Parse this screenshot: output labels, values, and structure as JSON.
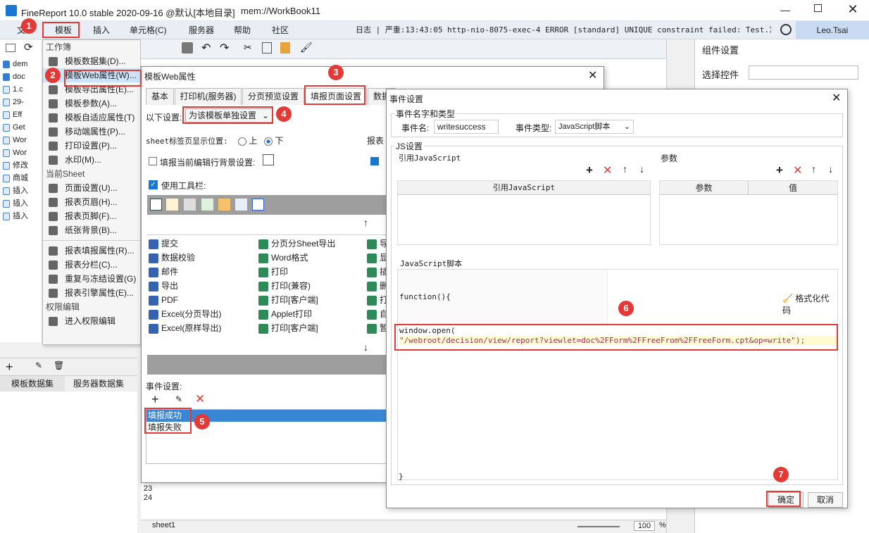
{
  "app": {
    "title": "FineReport 10.0 stable 2020-09-16 @默认[本地目录]",
    "workbook": "mem://WorkBook11"
  },
  "menu": {
    "items": [
      "文",
      "模板",
      "插入",
      "单元格(C)",
      "服务器",
      "帮助",
      "社区"
    ],
    "log": "日志 | 严重:13:43:05 http-nio-8075-exec-4 ERROR [standard] UNIQUE constraint failed: Test.ID",
    "user": "Leo.Tsai"
  },
  "dropdown": {
    "sec1": "工作簿",
    "items1": [
      "模板数据集(D)...",
      "模板Web属性(W)...",
      "模板导出属性(E)...",
      "模板参数(A)...",
      "模板自适应属性(T)",
      "移动端属性(P)...",
      "打印设置(P)...",
      "水印(M)..."
    ],
    "sec2": "当前Sheet",
    "items2": [
      "页面设置(U)...",
      "报表页眉(H)...",
      "报表页脚(F)...",
      "纸张背景(B)..."
    ],
    "items3": [
      "报表填报属性(R)...",
      "报表分栏(C)...",
      "重复与冻结设置(G)",
      "报表引擎属性(E)..."
    ],
    "sec3": "权限编辑",
    "items4": [
      "进入权限编辑"
    ]
  },
  "tree": [
    "dem",
    "doc",
    "1.c",
    "29-",
    "Eff",
    "Get",
    "Wor",
    "Wor",
    "修改",
    "商城",
    "插入",
    "插入",
    "插入"
  ],
  "leftTabs": [
    "模板数据集",
    "服务器数据集"
  ],
  "rightPanel": {
    "title": "组件设置",
    "selectLabel": "选择控件"
  },
  "webDialog": {
    "title": "模板Web属性",
    "tabs": [
      "基本",
      "打印机(服务器)",
      "分页预览设置",
      "填报页面设置",
      "数据"
    ],
    "settingLabel": "以下设置:",
    "settingValue": "为该模板单独设置",
    "sheetPos": "sheet标签页显示位置:",
    "up": "上",
    "down": "下",
    "reportLabel": "报表",
    "bgLabel": "填报当前编辑行背景设置:",
    "toolbarLabel": "使用工具栏:",
    "col1": [
      "提交",
      "数据校验",
      "邮件",
      "导出",
      "PDF",
      "Excel(分页导出)",
      "Excel(原样导出)"
    ],
    "col2": [
      "分页分Sheet导出",
      "Word格式",
      "打印",
      "打印(兼容)",
      "打印[客户端]",
      "Applet打印",
      "打印[客户端]"
    ],
    "col3": [
      "导",
      "显",
      "插",
      "删",
      "打",
      "自",
      "暂"
    ],
    "eventLabel": "事件设置:",
    "events": [
      "填报成功",
      "填报失败"
    ]
  },
  "eventDialog": {
    "title": "事件设置",
    "nameSection": "事件名字和类型",
    "nameLabel": "事件名:",
    "nameValue": "writesuccess",
    "typeLabel": "事件类型:",
    "typeValue": "JavaScript脚本",
    "jsSection": "JS设置",
    "refLabel": "引用JavaScript",
    "paramLabel": "参数",
    "refHeader": "引用JavaScript",
    "paramHeaders": [
      "参数",
      "值"
    ],
    "scriptLabel": "JavaScript脚本",
    "funcStart": "function(){",
    "format": "格式化代码",
    "code1": "window.open(",
    "code2": "\"/webroot/decision/view/report?viewlet=doc%2FForm%2FFreeFrom%2FFreeForm.cpt&op=write\");",
    "closeBrace": "}",
    "ok": "确定",
    "cancel": "取消"
  },
  "badges": [
    "1",
    "2",
    "3",
    "4",
    "5",
    "6",
    "7"
  ],
  "rows": [
    "23",
    "24"
  ],
  "bottom": {
    "sheet": "sheet1",
    "zoom": "100",
    "percent": "%"
  }
}
